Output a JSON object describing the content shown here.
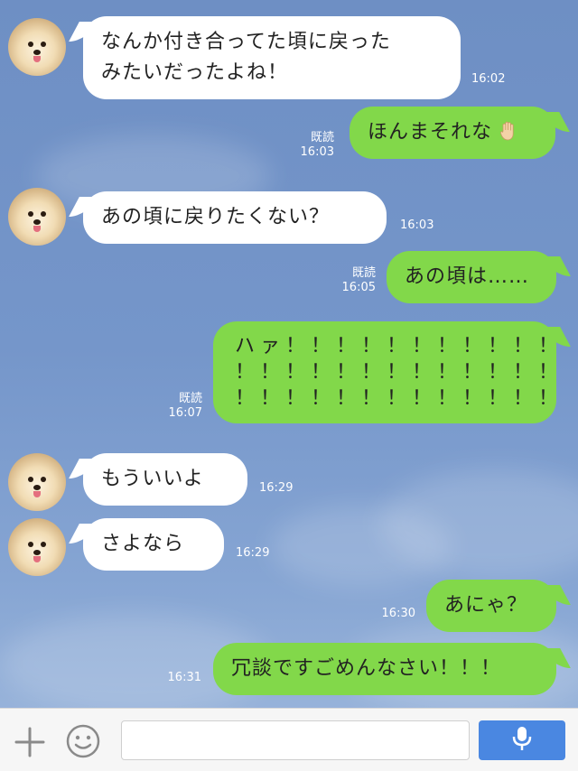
{
  "messages": [
    {
      "side": "in",
      "lines": [
        "なんか付き合ってた頃に戻った",
        "みたいだったよね！"
      ],
      "time": "16:02"
    },
    {
      "side": "out",
      "text": "ほんまそれな",
      "icon": "raised-hand-emoji",
      "read": "既読",
      "time": "16:03"
    },
    {
      "side": "in",
      "text": "あの頃に戻りたくない？",
      "time": "16:03"
    },
    {
      "side": "out",
      "text": "あの頃は……",
      "read": "既読",
      "time": "16:05"
    },
    {
      "side": "out",
      "lines": [
        "ハァ！！！！！！！！！！！",
        "！！！！！！！！！！！！！",
        "！！！！！！！！！！！！！"
      ],
      "read": "既読",
      "time": "16:07"
    },
    {
      "side": "in",
      "text": "もういいよ",
      "time": "16:29"
    },
    {
      "side": "in",
      "text": "さよなら",
      "time": "16:29"
    },
    {
      "side": "out",
      "text": "あにゃ？",
      "time": "16:30"
    },
    {
      "side": "out",
      "text": "冗談ですごめんなさい！！！",
      "time": "16:31"
    }
  ],
  "toolbar": {
    "icons": [
      "plus-icon",
      "emoji-icon",
      "microphone-icon"
    ],
    "input_value": "",
    "input_placeholder": ""
  },
  "colors": {
    "background": "#7596ca",
    "outgoing_bubble": "#82d84a",
    "incoming_bubble": "#ffffff",
    "mic_button": "#4a87e1"
  }
}
